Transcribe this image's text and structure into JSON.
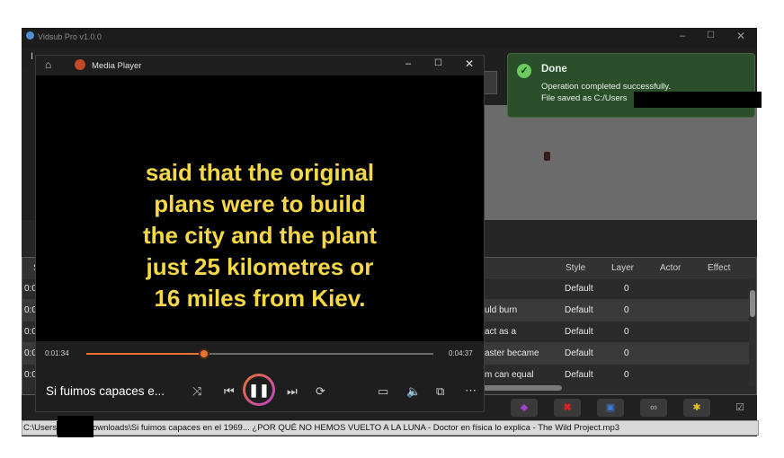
{
  "app": {
    "title": "Vidsub Pro v1.0.0",
    "menu_first": "I"
  },
  "toast": {
    "title": "Done",
    "line1": "Operation completed successfully.",
    "line2": "File saved as C:/Users"
  },
  "player": {
    "title": "Media Player",
    "subtitle_lines": [
      "said that the original",
      "plans were to build",
      "the city and the plant",
      "just 25 kilometres or",
      "16 miles from Kiev."
    ],
    "time_current": "0:01:34",
    "time_total": "0:04:37",
    "progress": 0.34,
    "track_title": "Si fuimos capaces e..."
  },
  "grid": {
    "headers": {
      "s": "S",
      "style": "Style",
      "layer": "Layer",
      "actor": "Actor",
      "effect": "Effect"
    },
    "rows": [
      {
        "start": "0:0",
        "text": "",
        "style": "Default",
        "layer": "0"
      },
      {
        "start": "0:0",
        "text": "uld burn",
        "style": "Default",
        "layer": "0"
      },
      {
        "start": "0:0",
        "text": "act as a",
        "style": "Default",
        "layer": "0"
      },
      {
        "start": "0:0",
        "text": "aster became",
        "style": "Default",
        "layer": "0"
      },
      {
        "start": "0:0",
        "text": "m can equal",
        "style": "Default",
        "layer": "0"
      }
    ]
  },
  "path": {
    "start": "C:\\Users",
    "rest": "ownloads\\Si fuimos capaces en el 1969... ¿POR QUÉ NO HEMOS VUELTO A LA LUNA - Doctor en física lo explica - The Wild Project.mp3"
  },
  "colors": {
    "accent": "#e8752a",
    "subtitle": "#f4d848",
    "toast_bg": "#2b4e2b"
  }
}
